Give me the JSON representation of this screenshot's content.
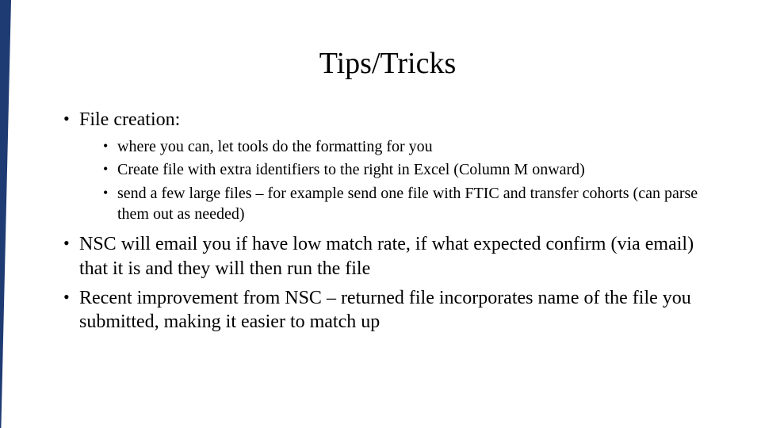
{
  "title": "Tips/Tricks",
  "bullets": {
    "b1": "File creation:",
    "sub": {
      "s1": "where you can, let tools do the formatting for you",
      "s2": "Create file with extra identifiers to the right in Excel (Column M onward)",
      "s3": "send a few large files – for example send one file with FTIC and transfer cohorts (can parse them out as needed)"
    },
    "b2": "NSC will email you if have low match rate, if what expected confirm (via email) that it is and they will then run the file",
    "b3": "Recent improvement from NSC – returned file incorporates name of the file you submitted, making it easier to match up"
  }
}
